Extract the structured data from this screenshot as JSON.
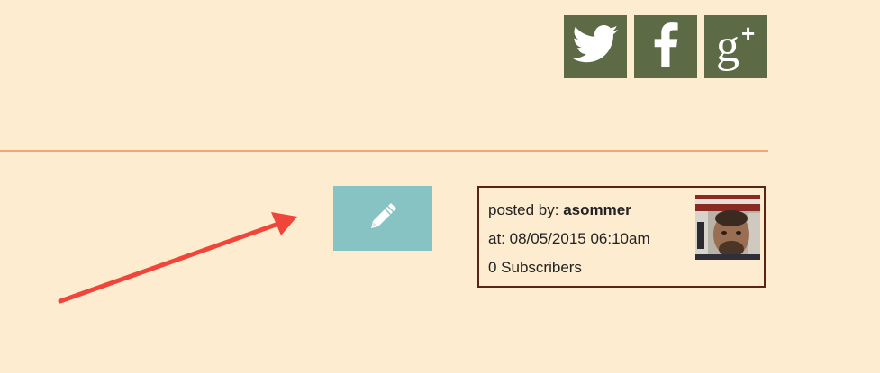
{
  "social": {
    "items": [
      {
        "icon": "twitter-icon",
        "color": "#5c6b46"
      },
      {
        "icon": "facebook-icon",
        "color": "#5c6b46"
      },
      {
        "icon": "google-plus-icon",
        "color": "#5c6b46"
      }
    ]
  },
  "edit": {
    "icon": "pencil-icon",
    "color": "#87c3c2"
  },
  "annotation": {
    "icon": "red-arrow",
    "color": "#f04538"
  },
  "post_info": {
    "posted_by_label": "posted by:",
    "username": "asommer",
    "at_label": "at:",
    "timestamp": "08/05/2015 06:10am",
    "subscribers": "0 Subscribers"
  },
  "colors": {
    "background": "#feecd0",
    "divider": "#eea87a",
    "border": "#5a2412"
  }
}
